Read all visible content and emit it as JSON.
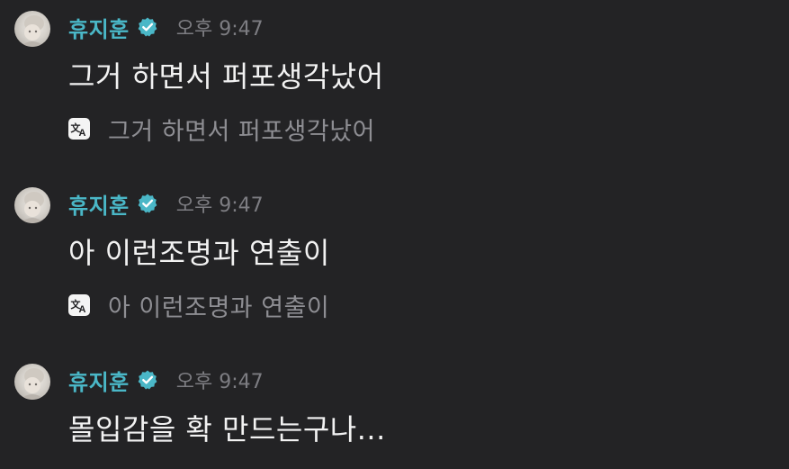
{
  "colors": {
    "background": "#232325",
    "username": "#4ab7c7",
    "verified_badge": "#4ab7c7",
    "message_text": "#f2f2f2",
    "timestamp": "#7d7d82",
    "translation_text": "#8e8e93"
  },
  "messages": [
    {
      "author": "휴지훈",
      "time": "오후 9:47",
      "text": "그거 하면서 퍼포생각났어",
      "translation": "그거 하면서 퍼포생각났어",
      "avatar_icon": "avatar-photo",
      "badge_icon": "verified-check-icon",
      "translate_icon": "translate-icon"
    },
    {
      "author": "휴지훈",
      "time": "오후 9:47",
      "text": "아 이런조명과 연출이",
      "translation": "아 이런조명과 연출이",
      "avatar_icon": "avatar-photo",
      "badge_icon": "verified-check-icon",
      "translate_icon": "translate-icon"
    },
    {
      "author": "휴지훈",
      "time": "오후 9:47",
      "text": "몰입감을 확 만드는구나...",
      "avatar_icon": "avatar-photo",
      "badge_icon": "verified-check-icon"
    }
  ]
}
